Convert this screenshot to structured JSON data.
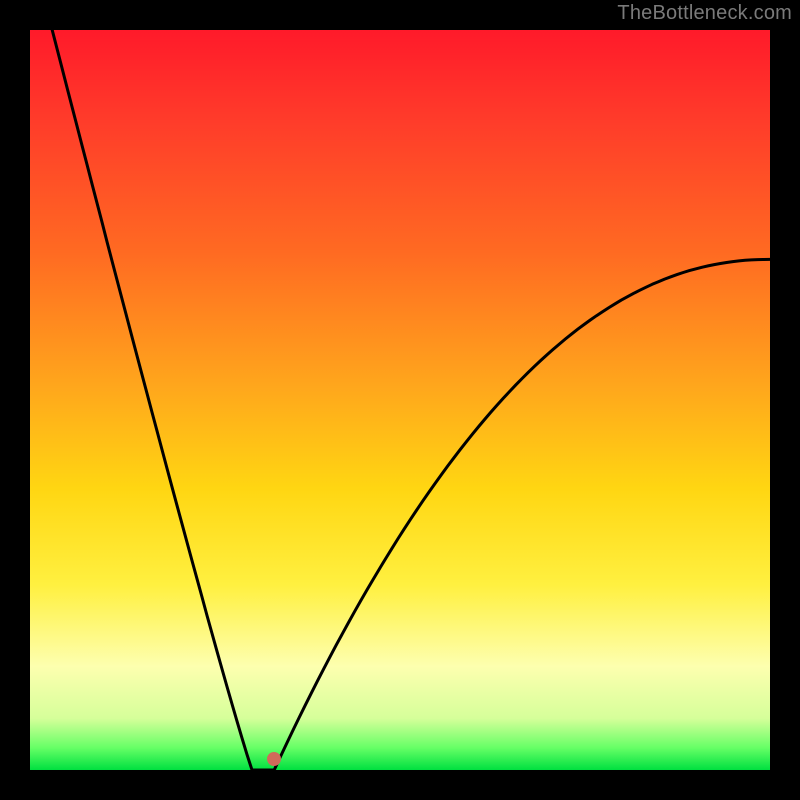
{
  "watermark": "TheBottleneck.com",
  "chart_data": {
    "type": "line",
    "title": "",
    "xlabel": "",
    "ylabel": "",
    "xlim": [
      0,
      100
    ],
    "ylim": [
      0,
      100
    ],
    "curve": {
      "left_branch_start_x": 3,
      "vertex_x": 30,
      "flat_x_end": 33,
      "right_end_x": 100,
      "right_end_y": 69
    },
    "marker": {
      "x": 33,
      "y": 1.5
    },
    "background_gradient": {
      "top": "#ff1a2a",
      "bottom": "#00e040"
    }
  }
}
